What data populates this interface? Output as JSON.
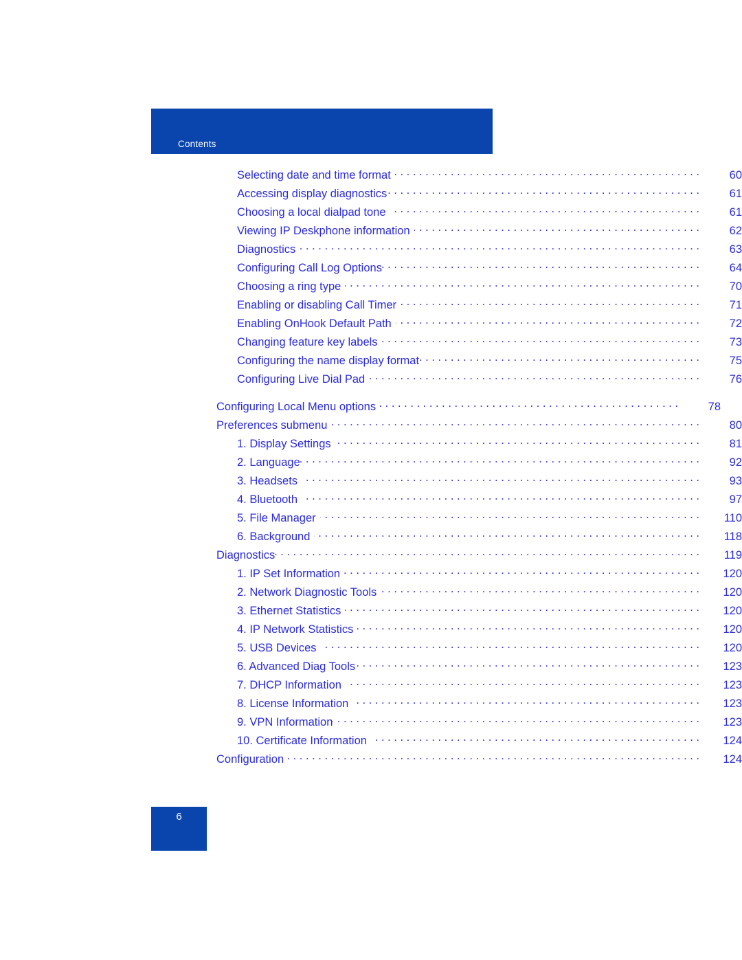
{
  "document": {
    "header_label": "Contents",
    "page_number": "6",
    "accent_color": "#0a45ae",
    "link_color": "#2b2bdb"
  },
  "toc": {
    "groups": [
      {
        "id": "group-options",
        "entries": [
          {
            "label": "Selecting date and time format",
            "page": "60",
            "level": 2
          },
          {
            "label": "Accessing display diagnostics",
            "page": "61",
            "level": 2,
            "tight": true
          },
          {
            "label": "Choosing a local dialpad tone",
            "page": "61",
            "level": 2
          },
          {
            "label": "Viewing IP Deskphone information",
            "page": "62",
            "level": 2
          },
          {
            "label": "Diagnostics",
            "page": "63",
            "level": 2,
            "tight": true
          },
          {
            "label": "Configuring Call Log Options",
            "page": "64",
            "level": 2,
            "tight": true
          },
          {
            "label": "Choosing a ring type",
            "page": "70",
            "level": 2
          },
          {
            "label": "Enabling or disabling Call Timer",
            "page": "71",
            "level": 2
          },
          {
            "label": "Enabling OnHook Default Path",
            "page": "72",
            "level": 2
          },
          {
            "label": "Changing feature key labels",
            "page": "73",
            "level": 2,
            "tight": true
          },
          {
            "label": "Configuring the name display format",
            "page": "75",
            "level": 2,
            "tight": true
          },
          {
            "label": "Configuring Live Dial Pad",
            "page": "76",
            "level": 2,
            "tight": true
          }
        ]
      },
      {
        "id": "group-local-menu",
        "entries": [
          {
            "label": "Configuring Local Menu options",
            "page": "78",
            "level": 1,
            "shift_left": true
          },
          {
            "label": "Preferences submenu",
            "page": "80",
            "level": 1
          },
          {
            "label": "1. Display Settings",
            "page": "81",
            "level": 2
          },
          {
            "label": "2. Language",
            "page": "92",
            "level": 2,
            "tight": true
          },
          {
            "label": "3. Headsets",
            "page": "93",
            "level": 2
          },
          {
            "label": "4. Bluetooth",
            "page": "97",
            "level": 2
          },
          {
            "label": "5. File Manager",
            "page": "110",
            "level": 2
          },
          {
            "label": "6. Background",
            "page": "118",
            "level": 2
          },
          {
            "label": "Diagnostics",
            "page": "119",
            "level": 1,
            "tight": true
          },
          {
            "label": "1. IP Set Information",
            "page": "120",
            "level": 2
          },
          {
            "label": "2. Network Diagnostic Tools",
            "page": "120",
            "level": 2
          },
          {
            "label": "3. Ethernet Statistics",
            "page": "120",
            "level": 2
          },
          {
            "label": "4. IP Network Statistics",
            "page": "120",
            "level": 2
          },
          {
            "label": "5. USB Devices",
            "page": "120",
            "level": 2
          },
          {
            "label": "6. Advanced Diag Tools",
            "page": "123",
            "level": 2,
            "tight": true
          },
          {
            "label": "7. DHCP Information",
            "page": "123",
            "level": 2
          },
          {
            "label": "8. License Information",
            "page": "123",
            "level": 2
          },
          {
            "label": "9. VPN Information",
            "page": "123",
            "level": 2,
            "tight": true
          },
          {
            "label": "10. Certificate Information",
            "page": "124",
            "level": 2
          },
          {
            "label": "Configuration",
            "page": "124",
            "level": 1
          }
        ]
      }
    ]
  }
}
